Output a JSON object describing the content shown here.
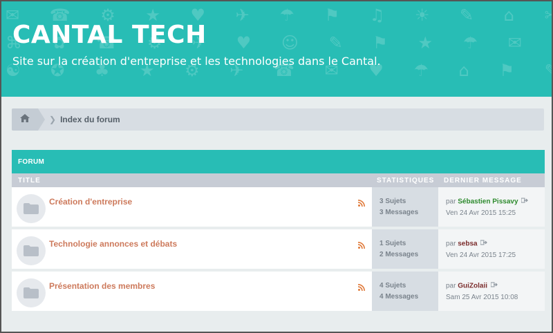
{
  "header": {
    "title": "CANTAL TECH",
    "description": "Site sur la création d'entreprise et les technologies dans le Cantal.",
    "accent_color": "#28bdb5"
  },
  "breadcrumb": {
    "home_icon": "home-icon",
    "label": "Index du forum"
  },
  "forum": {
    "section_title": "FORUM",
    "columns": {
      "title": "TITLE",
      "stats": "STATISTIQUES",
      "last": "DERNIER MESSAGE"
    },
    "rows": [
      {
        "title": "Création d'entreprise",
        "topics": "3 Sujets",
        "messages": "3 Messages",
        "by": "par",
        "author": "Sébastien Pissavy",
        "author_color": "#2e8b2e",
        "date": "Ven 24 Avr 2015 15:25"
      },
      {
        "title": "Technologie annonces et débats",
        "topics": "1 Sujets",
        "messages": "2 Messages",
        "by": "par",
        "author": "sebsa",
        "author_color": "#7b2d2d",
        "date": "Ven 24 Avr 2015 17:25"
      },
      {
        "title": "Présentation des membres",
        "topics": "4 Sujets",
        "messages": "4 Messages",
        "by": "par",
        "author": "GuiZolaii",
        "author_color": "#7b2d2d",
        "date": "Sam 25 Avr 2015 10:08"
      }
    ]
  }
}
